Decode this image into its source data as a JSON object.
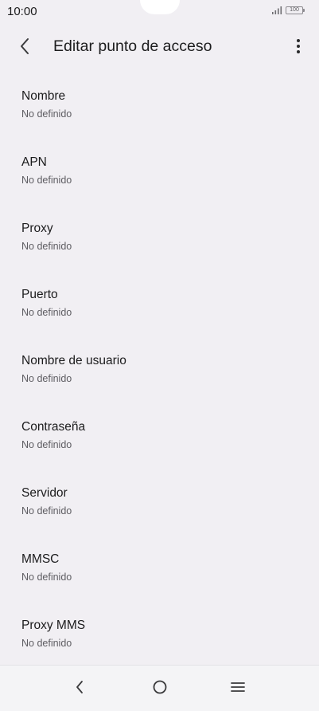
{
  "status_bar": {
    "time": "10:00",
    "battery": "100",
    "icons": [
      "signal-icon",
      "battery-icon"
    ]
  },
  "app_bar": {
    "title": "Editar punto de acceso",
    "back_icon": "back-arrow-icon",
    "menu_icon": "more-vertical-icon"
  },
  "items": [
    {
      "title": "Nombre",
      "value": "No definido"
    },
    {
      "title": "APN",
      "value": "No definido"
    },
    {
      "title": "Proxy",
      "value": "No definido"
    },
    {
      "title": "Puerto",
      "value": "No definido"
    },
    {
      "title": "Nombre de usuario",
      "value": "No definido"
    },
    {
      "title": "Contraseña",
      "value": "No definido"
    },
    {
      "title": "Servidor",
      "value": "No definido"
    },
    {
      "title": "MMSC",
      "value": "No definido"
    },
    {
      "title": "Proxy MMS",
      "value": "No definido"
    }
  ],
  "nav_bar": {
    "icons": [
      "nav-back-icon",
      "nav-home-icon",
      "nav-recents-icon"
    ]
  },
  "colors": {
    "background": "#f1eff3",
    "text_primary": "#1c1c1d",
    "text_secondary": "#5e5d62",
    "nav_background": "#f4f4f6"
  }
}
